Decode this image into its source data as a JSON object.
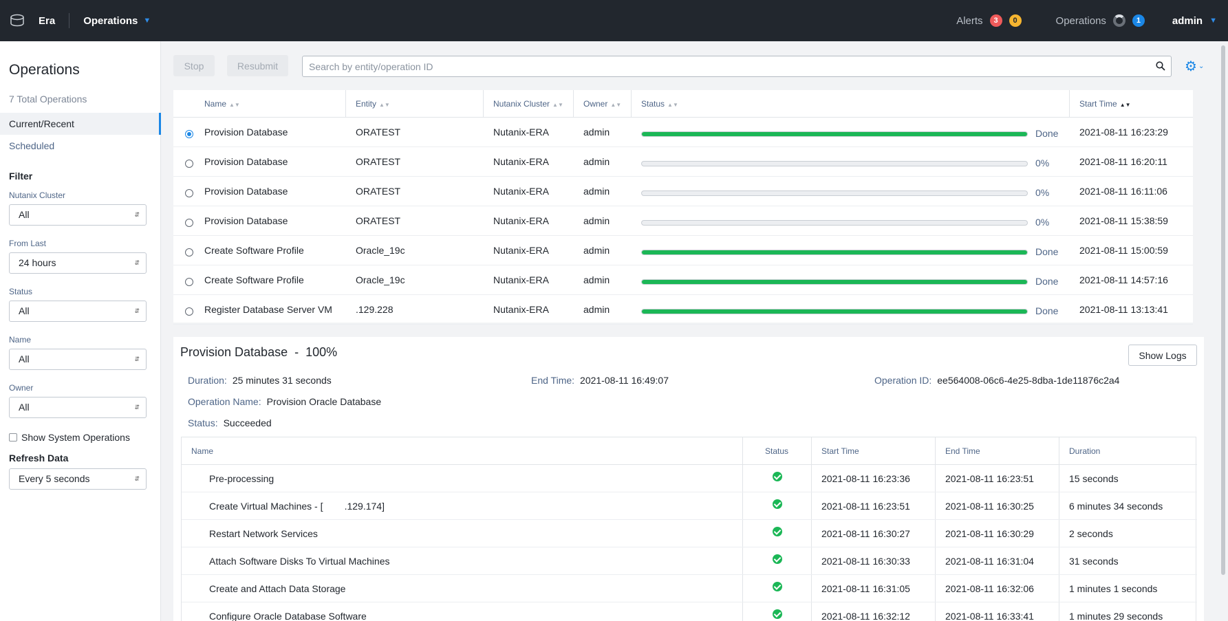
{
  "topbar": {
    "brand": "Era",
    "section": "Operations",
    "alerts_label": "Alerts",
    "alerts_red": "3",
    "alerts_yellow": "0",
    "operations_label": "Operations",
    "operations_count": "1",
    "user": "admin"
  },
  "sidebar": {
    "title": "Operations",
    "total": "7 Total Operations",
    "nav": [
      "Current/Recent",
      "Scheduled"
    ],
    "filter_title": "Filter",
    "filters": [
      {
        "label": "Nutanix Cluster",
        "value": "All"
      },
      {
        "label": "From Last",
        "value": "24 hours"
      },
      {
        "label": "Status",
        "value": "All"
      },
      {
        "label": "Name",
        "value": "All"
      },
      {
        "label": "Owner",
        "value": "All"
      }
    ],
    "show_system": "Show System Operations",
    "refresh_title": "Refresh Data",
    "refresh_value": "Every 5 seconds"
  },
  "toolbar": {
    "stop": "Stop",
    "resubmit": "Resubmit",
    "search_placeholder": "Search by entity/operation ID"
  },
  "ops": {
    "columns": [
      "Name",
      "Entity",
      "Nutanix Cluster",
      "Owner",
      "Status",
      "Start Time"
    ],
    "rows": [
      {
        "name": "Provision Database",
        "entity": "ORATEST",
        "cluster": "Nutanix-ERA",
        "owner": "admin",
        "progress": 100,
        "status": "Done",
        "start": "2021-08-11 16:23:29",
        "selected": true
      },
      {
        "name": "Provision Database",
        "entity": "ORATEST",
        "cluster": "Nutanix-ERA",
        "owner": "admin",
        "progress": 0,
        "status": "0%",
        "start": "2021-08-11 16:20:11",
        "selected": false
      },
      {
        "name": "Provision Database",
        "entity": "ORATEST",
        "cluster": "Nutanix-ERA",
        "owner": "admin",
        "progress": 0,
        "status": "0%",
        "start": "2021-08-11 16:11:06",
        "selected": false
      },
      {
        "name": "Provision Database",
        "entity": "ORATEST",
        "cluster": "Nutanix-ERA",
        "owner": "admin",
        "progress": 0,
        "status": "0%",
        "start": "2021-08-11 15:38:59",
        "selected": false
      },
      {
        "name": "Create Software Profile",
        "entity": "Oracle_19c",
        "cluster": "Nutanix-ERA",
        "owner": "admin",
        "progress": 100,
        "status": "Done",
        "start": "2021-08-11 15:00:59",
        "selected": false
      },
      {
        "name": "Create Software Profile",
        "entity": "Oracle_19c",
        "cluster": "Nutanix-ERA",
        "owner": "admin",
        "progress": 100,
        "status": "Done",
        "start": "2021-08-11 14:57:16",
        "selected": false
      },
      {
        "name": "Register Database Server VM",
        "entity": ".129.228",
        "cluster": "Nutanix-ERA",
        "owner": "admin",
        "progress": 100,
        "status": "Done",
        "start": "2021-08-11 13:13:41",
        "selected": false
      }
    ]
  },
  "details": {
    "title": "Provision Database  -  100%",
    "show_logs": "Show Logs",
    "duration_label": "Duration:",
    "duration": "25 minutes 31 seconds",
    "end_label": "End Time:",
    "end": "2021-08-11 16:49:07",
    "opid_label": "Operation ID:",
    "opid": "ee564008-06c6-4e25-8dba-1de11876c2a4",
    "opname_label": "Operation Name:",
    "opname": "Provision Oracle Database",
    "status_label": "Status:",
    "status": "Succeeded",
    "columns": [
      "Name",
      "Status",
      "Start Time",
      "End Time",
      "Duration"
    ],
    "steps": [
      {
        "name": "Pre-processing",
        "start": "2021-08-11 16:23:36",
        "end": "2021-08-11 16:23:51",
        "duration": "15 seconds"
      },
      {
        "name": "Create Virtual Machines - [        .129.174]",
        "start": "2021-08-11 16:23:51",
        "end": "2021-08-11 16:30:25",
        "duration": "6 minutes 34 seconds"
      },
      {
        "name": "Restart Network Services",
        "start": "2021-08-11 16:30:27",
        "end": "2021-08-11 16:30:29",
        "duration": "2 seconds"
      },
      {
        "name": "Attach Software Disks To Virtual Machines",
        "start": "2021-08-11 16:30:33",
        "end": "2021-08-11 16:31:04",
        "duration": "31 seconds"
      },
      {
        "name": "Create and Attach Data Storage",
        "start": "2021-08-11 16:31:05",
        "end": "2021-08-11 16:32:06",
        "duration": "1 minutes 1 seconds"
      },
      {
        "name": "Configure Oracle Database Software",
        "start": "2021-08-11 16:32:12",
        "end": "2021-08-11 16:33:41",
        "duration": "1 minutes 29 seconds"
      }
    ]
  },
  "colors": {
    "accent": "#1b87e6",
    "success": "#1bb756",
    "topbar": "#22272e"
  }
}
